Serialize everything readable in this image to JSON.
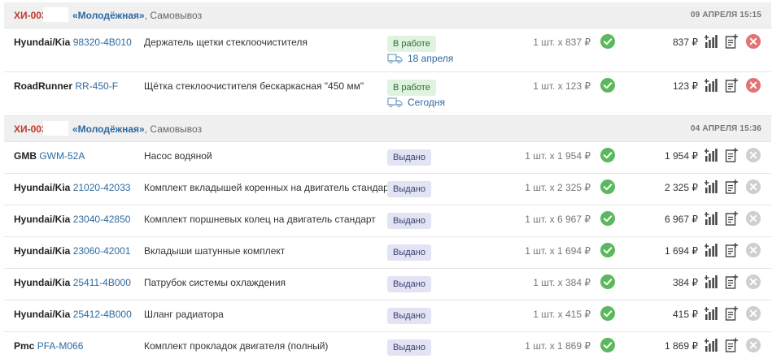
{
  "currency": "₽",
  "groups": [
    {
      "order_id": "ХИ-003",
      "store": "«Молодёжная»",
      "delivery_type": ", Самовывоз",
      "date": "09 АПРЕЛЯ 15:15",
      "items": [
        {
          "brand": "Hyundai/Kia",
          "code": "98320-4B010",
          "name": "Держатель щетки стеклоочистителя",
          "status": "В работе",
          "delivery": "18 апреля",
          "qty": "1 шт. x 837 ₽",
          "total": "837 ₽"
        },
        {
          "brand": "RoadRunner",
          "code": "RR-450-F",
          "name": "Щётка стеклоочистителя бескаркасная \"450 мм\"",
          "status": "В работе",
          "delivery": "Сегодня",
          "qty": "1 шт. x 123 ₽",
          "total": "123 ₽"
        }
      ]
    },
    {
      "order_id": "ХИ-003",
      "store": "«Молодёжная»",
      "delivery_type": ", Самовывоз",
      "date": "04 АПРЕЛЯ 15:36",
      "items": [
        {
          "brand": "GMB",
          "code": "GWM-52A",
          "name": "Насос водяной",
          "status": "Выдано",
          "qty": "1 шт. x 1 954 ₽",
          "total": "1 954 ₽"
        },
        {
          "brand": "Hyundai/Kia",
          "code": "21020-42033",
          "name": "Комплект вкладышей коренных на двигатель стандарт",
          "status": "Выдано",
          "qty": "1 шт. x 2 325 ₽",
          "total": "2 325 ₽"
        },
        {
          "brand": "Hyundai/Kia",
          "code": "23040-42850",
          "name": "Комплект поршневых колец на двигатель стандарт",
          "status": "Выдано",
          "qty": "1 шт. x 6 967 ₽",
          "total": "6 967 ₽"
        },
        {
          "brand": "Hyundai/Kia",
          "code": "23060-42001",
          "name": "Вкладыши шатунные комплект",
          "status": "Выдано",
          "qty": "1 шт. x 1 694 ₽",
          "total": "1 694 ₽"
        },
        {
          "brand": "Hyundai/Kia",
          "code": "25411-4B000",
          "name": "Патрубок системы охлаждения",
          "status": "Выдано",
          "qty": "1 шт. x 384 ₽",
          "total": "384 ₽"
        },
        {
          "brand": "Hyundai/Kia",
          "code": "25412-4B000",
          "name": "Шланг радиатора",
          "status": "Выдано",
          "qty": "1 шт. x 415 ₽",
          "total": "415 ₽"
        },
        {
          "brand": "Pmc",
          "code": "PFA-M066",
          "name": "Комплект прокладок двигателя (полный)",
          "status": "Выдано",
          "qty": "1 шт. x 1 869 ₽",
          "total": "1 869 ₽"
        }
      ]
    }
  ],
  "colors": {
    "accent_red": "#c0392b",
    "link_blue": "#2e6aa0",
    "ok_green": "#5cb85c",
    "cancel_red": "#e57373",
    "disabled_gray": "#cfcfcf"
  },
  "icons": [
    "check-circle-icon",
    "bar-chart-icon",
    "document-add-icon",
    "cancel-icon",
    "truck-icon"
  ]
}
